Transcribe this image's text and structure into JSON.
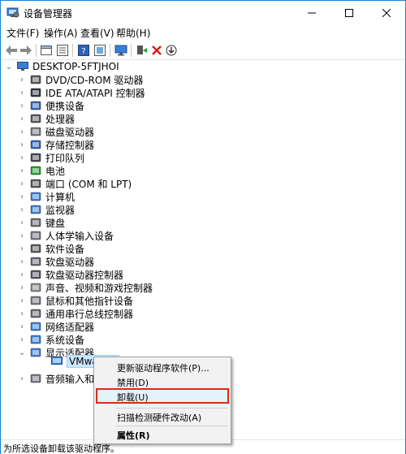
{
  "window": {
    "title": "设备管理器",
    "icons": {
      "app": "device-manager-icon"
    }
  },
  "menu": [
    "文件(F)",
    "操作(A)",
    "查看(V)",
    "帮助(H)"
  ],
  "tree": {
    "root": "DESKTOP-5FTJHOI",
    "categories": [
      "DVD/CD-ROM 驱动器",
      "IDE ATA/ATAPI 控制器",
      "便携设备",
      "处理器",
      "磁盘驱动器",
      "存储控制器",
      "打印队列",
      "电池",
      "端口 (COM 和 LPT)",
      "计算机",
      "监视器",
      "键盘",
      "人体学输入设备",
      "软件设备",
      "软盘驱动器",
      "软盘驱动器控制器",
      "声音、视频和游戏控制器",
      "鼠标和其他指针设备",
      "通用串行总线控制器",
      "网络适配器",
      "系统设备",
      "显示适配器",
      "音频输入和输出"
    ],
    "display_child": "VMware S",
    "audio_truncated": "音频输入和输出"
  },
  "context_menu": {
    "update": "更新驱动程序软件(P)...",
    "disable": "禁用(D)",
    "uninstall": "卸载(U)",
    "scan": "扫描检测硬件改动(A)",
    "properties": "属性(R)"
  },
  "status": "为所选设备卸载该驱动程序。",
  "colors": {
    "accent": "#1883d7",
    "highlight_border": "#e0281b",
    "selection": "#cce8ff"
  }
}
